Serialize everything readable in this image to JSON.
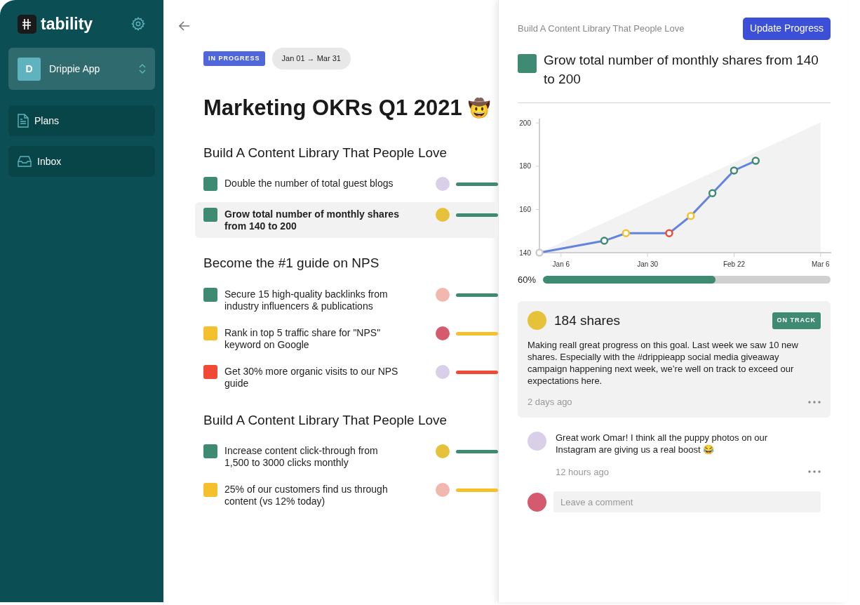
{
  "sidebar": {
    "logo": "tability",
    "workspace": {
      "initial": "D",
      "name": "Drippie App"
    },
    "items": [
      {
        "label": "Plans"
      },
      {
        "label": "Inbox"
      }
    ]
  },
  "plan": {
    "status": "IN PROGRESS",
    "dates": "Jan 01 → Mar 31",
    "title": "Marketing OKRs Q1 2021",
    "emoji": "🤠",
    "objectives": [
      {
        "title": "Build A Content Library That People Love",
        "results": [
          {
            "text": "Double the number of total guest blogs",
            "color": "#3f8a72",
            "selected": false
          },
          {
            "text": "Grow total number of monthly shares from 140 to 200",
            "color": "#3f8a72",
            "selected": true
          }
        ]
      },
      {
        "title": "Become the #1 guide on NPS",
        "results": [
          {
            "text": "Secure 15 high-quality backlinks from industry influencers & publications",
            "color": "#3f8a72",
            "selected": false
          },
          {
            "text": "Rank in top 5 traffic share for \"NPS\" keyword on Google",
            "color": "#f4c02c",
            "selected": false
          },
          {
            "text": "Get 30% more organic visits to our NPS guide",
            "color": "#f04a37",
            "selected": false
          }
        ]
      },
      {
        "title": "Build A Content Library That People Love",
        "results": [
          {
            "text": "Increase content click-through from 1,500 to 3000 clicks monthly",
            "color": "#3f8a72",
            "selected": false
          },
          {
            "text": "25% of our customers find us through content (vs 12% today)",
            "color": "#f4c02c",
            "selected": false
          }
        ]
      }
    ]
  },
  "panel": {
    "breadcrumb": "Build A Content Library That People Love",
    "button": "Update Progress",
    "title": "Grow total number of monthly shares from 140 to 200",
    "color": "#3f8a72",
    "chart_data": {
      "type": "line",
      "categories": [
        null,
        "Jan 6",
        null,
        null,
        null,
        "Jan 30",
        null,
        null,
        null,
        "Feb 22",
        null,
        null,
        null,
        "Mar 6"
      ],
      "series": [
        {
          "color": "#6383e0",
          "marker": "circle",
          "values": [
            140,
            null,
            null,
            145.5,
            149,
            null,
            149,
            157,
            167.5,
            178,
            182.5,
            null,
            null,
            null
          ]
        },
        {
          "color": "#f2f2f2",
          "type": "area",
          "values": [
            140,
            144.6,
            149.3,
            153.9,
            158.5,
            163.2,
            167.8,
            172.5,
            177.1,
            181.7,
            186.4,
            191,
            195.6,
            200.3
          ]
        }
      ],
      "ylim": [
        140,
        202
      ],
      "yticks": [
        140,
        160,
        180,
        200
      ]
    },
    "chart_markers": [
      {
        "color": "#cccccc"
      },
      {
        "color": "#3f8a72"
      },
      {
        "color": "#f4c02c"
      },
      {
        "color": "#f04a37"
      },
      {
        "color": "#f4c02c"
      },
      {
        "color": "#3f8a72"
      },
      {
        "color": "#3f8a72"
      },
      {
        "color": "#3f8a72"
      }
    ],
    "progress": {
      "label": "60%",
      "level": 0.6
    },
    "checkin": {
      "value": "184 shares",
      "status": "ON TRACK",
      "text": "Making reall great progress on this goal. Last week we saw 10 new shares. Especially with the #drippieapp social media giveaway campaign happening next week, we’re well on track to exceed our expectations here.",
      "time": "2 days ago"
    },
    "comments": [
      {
        "text": "Great work Omar! I think all the puppy photos on our Instagram are giving us a real boost 😂",
        "time": "12 hours ago"
      }
    ],
    "comment_field": {
      "placeholder": "Leave a comment"
    }
  }
}
